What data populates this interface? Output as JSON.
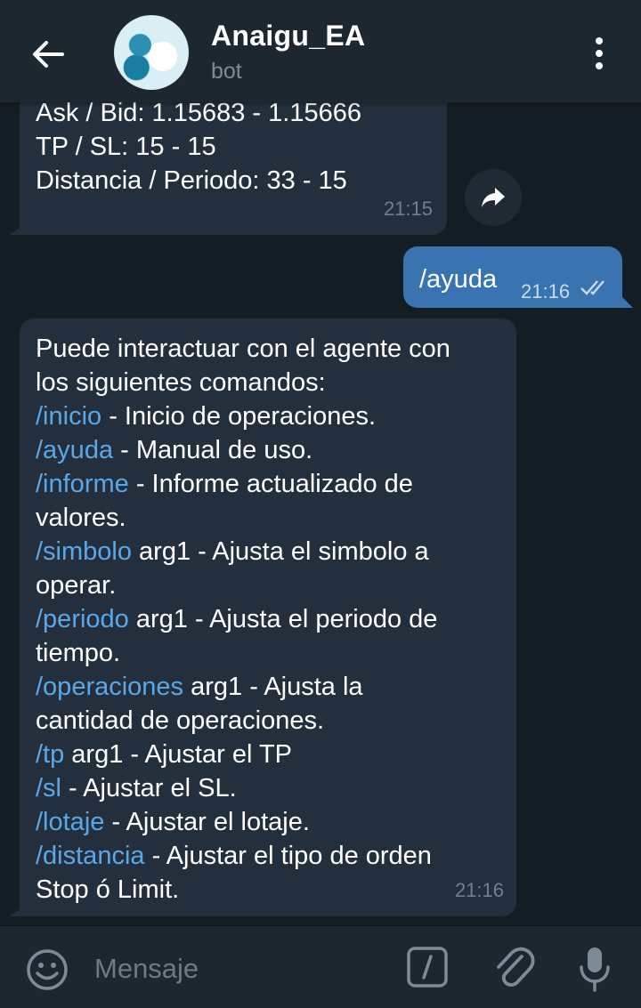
{
  "header": {
    "title": "Anaigu_EA",
    "subtitle": "bot"
  },
  "messages": {
    "m1": {
      "lines": [
        "Ask / Bid: 1.15683 - 1.15666",
        "TP / SL: 15 - 15",
        "Distancia / Periodo: 33 - 15"
      ],
      "time": "21:15"
    },
    "m2": {
      "text": "/ayuda",
      "time": "21:16"
    },
    "m3": {
      "intro1": "Puede interactuar con el agente con",
      "intro2": "los siguientes comandos:",
      "rows": [
        {
          "cmd": "/inicio",
          "rest": " - Inicio de operaciones."
        },
        {
          "cmd": "/ayuda",
          "rest": " - Manual de uso."
        },
        {
          "cmd": "/informe",
          "rest": " - Informe actualizado de"
        },
        {
          "cmd": "",
          "rest": "valores."
        },
        {
          "cmd": "/simbolo",
          "rest": " arg1 - Ajusta el simbolo a"
        },
        {
          "cmd": "",
          "rest": "operar."
        },
        {
          "cmd": "/periodo",
          "rest": " arg1 - Ajusta el periodo de"
        },
        {
          "cmd": "",
          "rest": "tiempo."
        },
        {
          "cmd": "/operaciones",
          "rest": " arg1 - Ajusta la"
        },
        {
          "cmd": "",
          "rest": "cantidad de operaciones."
        },
        {
          "cmd": "/tp",
          "rest": " arg1 - Ajustar el TP"
        },
        {
          "cmd": "/sl",
          "rest": " - Ajustar el SL."
        },
        {
          "cmd": "/lotaje",
          "rest": " - Ajustar el lotaje."
        },
        {
          "cmd": "/distancia",
          "rest": " - Ajustar el tipo de orden"
        },
        {
          "cmd": "",
          "rest": "Stop ó Limit."
        }
      ],
      "time": "21:16"
    }
  },
  "composer": {
    "placeholder": "Mensaje"
  },
  "icons": {
    "back": "arrow-left-icon",
    "menu": "more-vertical-icon",
    "forward": "forward-arrow-icon",
    "read": "double-check-icon",
    "emoji": "emoji-icon",
    "command": "slash-command-icon",
    "attach": "paperclip-icon",
    "mic": "microphone-icon"
  },
  "colors": {
    "background": "#151d24",
    "header": "#1d2730",
    "incoming_bubble": "#232f3d",
    "outgoing_bubble": "#3a74b0",
    "command_link": "#5aa8e8"
  }
}
